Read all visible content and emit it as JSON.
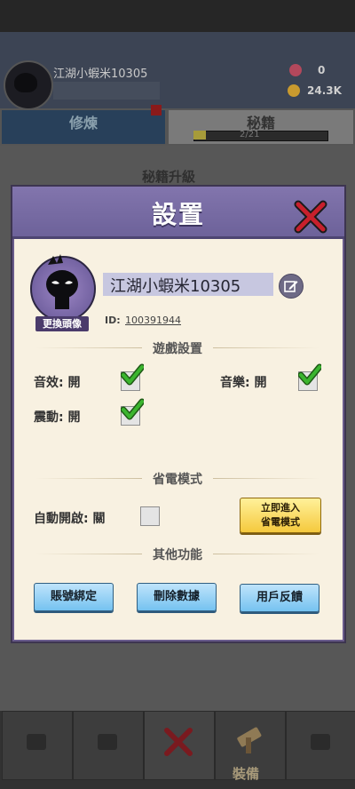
{
  "background": {
    "player_name": "江湖小蝦米10305",
    "resources": [
      {
        "icon": "gem-icon",
        "value": "0",
        "color": "#b3485c"
      },
      {
        "icon": "coin-icon",
        "value": "24.3K",
        "color": "#c99a2e"
      }
    ],
    "tabs": [
      "修煉",
      "秘籍"
    ],
    "progress": {
      "text": "2/21",
      "fraction": 0.095
    },
    "main_title": "秘籍升級",
    "bottom_nav": {
      "equip_label": "裝備"
    }
  },
  "dialog": {
    "title": "設置",
    "profile": {
      "name": "江湖小蝦米10305",
      "change_avatar": "更換頭像",
      "id_label": "ID:",
      "id_value": "100391944"
    },
    "game_settings": {
      "title": "遊戲設置",
      "sound": {
        "label": "音效: 開",
        "checked": true
      },
      "music": {
        "label": "音樂: 開",
        "checked": true
      },
      "vibration": {
        "label": "震動: 開",
        "checked": true
      }
    },
    "power_saving": {
      "title": "省電模式",
      "auto_label": "自動開啟: 關",
      "auto_checked": false,
      "enter_line1": "立即進入",
      "enter_line2": "省電模式"
    },
    "other": {
      "title": "其他功能",
      "bind_account": "賬號綁定",
      "delete_data": "刪除數據",
      "feedback": "用戶反饋"
    }
  },
  "colors": {
    "header": "#7568a2",
    "dialog_bg": "#f8f1e1",
    "check_green": "#3bb52f",
    "close_red": "#c8202c",
    "button_blue": "#8dcbf2",
    "button_yellow": "#f7d24f"
  }
}
